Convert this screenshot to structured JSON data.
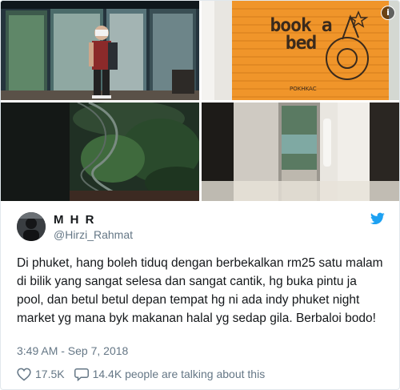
{
  "tweet": {
    "display_name": "M H R",
    "handle": "@Hirzi_Rahmat",
    "text": "Di phuket, hang boleh tiduq dengan berbekalkan rm25 satu malam di bilik yang sangat selesa dan sangat cantik, hg buka pintu ja pool, dan betul betul depan tempat hg ni ada indy phuket night market yg mana byk makanan halal yg sedap gila. Berbaloi bodo!",
    "timestamp": "3:49 AM - Sep 7, 2018",
    "like_count": "17.5K",
    "talking_label": "14.4K people are talking about this"
  },
  "media": {
    "info_label": "i",
    "sign_text": "book a bed",
    "sign_small": "POKHKAC"
  },
  "icons": {
    "twitter": "twitter-bird-icon",
    "like": "heart-icon",
    "reply": "speech-bubble-icon",
    "info": "info-icon"
  },
  "colors": {
    "twitter_blue": "#1da1f2",
    "secondary_text": "#657786",
    "sign_orange": "#f0952a"
  }
}
